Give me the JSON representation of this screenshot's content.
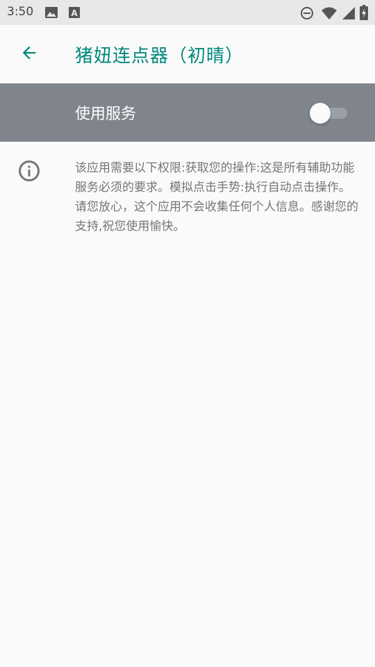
{
  "status_bar": {
    "time": "3:50",
    "left_icons": [
      "image-icon",
      "font-a-icon"
    ],
    "right_icons": [
      "do-not-disturb-icon",
      "wifi-icon",
      "signal-icon",
      "battery-charging-icon"
    ]
  },
  "app_bar": {
    "title": "猪妞连点器（初晴）",
    "back_icon": "arrow-back-icon",
    "accent_color": "#00897b"
  },
  "service_switch": {
    "label": "使用服务",
    "enabled": false,
    "background_color": "#80858d"
  },
  "info": {
    "icon": "info-icon",
    "text": "该应用需要以下权限:获取您的操作:这是所有辅助功能服务必须的要求。模拟点击手势:执行自动点击操作。请您放心，这个应用不会收集任何个人信息。感谢您的支持,祝您使用愉快。"
  }
}
